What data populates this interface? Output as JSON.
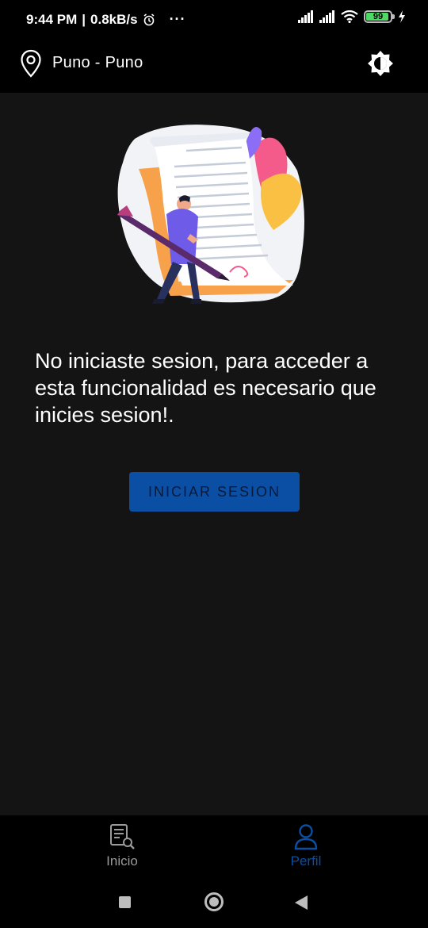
{
  "status_bar": {
    "time": "9:44 PM",
    "separator": "|",
    "speed": "0.8kB/s",
    "more": "···",
    "battery": "99",
    "icons": [
      "alarm-icon",
      "signal-icon",
      "signal-icon",
      "wifi-icon",
      "battery-icon",
      "charging-icon"
    ]
  },
  "header": {
    "location": "Puno - Puno",
    "icons": [
      "location-pin-icon",
      "brightness-icon"
    ]
  },
  "main": {
    "message": "No iniciaste sesion, para acceder a esta funcionalidad es necesario que inicies sesion!.",
    "button_label": "INICIAR SESION"
  },
  "nav": {
    "items": [
      {
        "label": "Inicio",
        "icon": "document-search-icon",
        "active": false
      },
      {
        "label": "Perfil",
        "icon": "user-icon",
        "active": true
      }
    ],
    "active_color": "#0a4fa3"
  },
  "colors": {
    "background": "#141414",
    "bars": "#000000",
    "button": "#0a4fa3"
  }
}
